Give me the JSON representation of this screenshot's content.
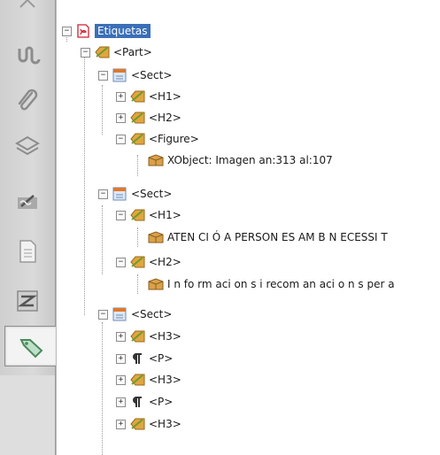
{
  "sidebar": {
    "buttons": [
      "attachments-link-icon",
      "paperclip-icon",
      "layers-icon",
      "signatures-icon",
      "page-icon",
      "content-icon",
      "tags-icon"
    ]
  },
  "tree": {
    "root_label": "Etiquetas",
    "part": "<Part>",
    "sect1": "<Sect>",
    "sect1_h1": "<H1>",
    "sect1_h2": "<H2>",
    "sect1_figure": "<Figure>",
    "sect1_xobject": "XObject: Imagen an:313 al:107",
    "sect2": "<Sect>",
    "sect2_h1": "<H1>",
    "sect2_h1_text": "ATEN CI Ó A PERSON ES AM B N ECESSI T",
    "sect2_h2": "<H2>",
    "sect2_h2_text": "I n fo rm aci on s i recom an aci o n s per a",
    "sect3": "<Sect>",
    "sect3_items": [
      "<H3>",
      "<P>",
      "<H3>",
      "<P>",
      "<H3>"
    ]
  }
}
